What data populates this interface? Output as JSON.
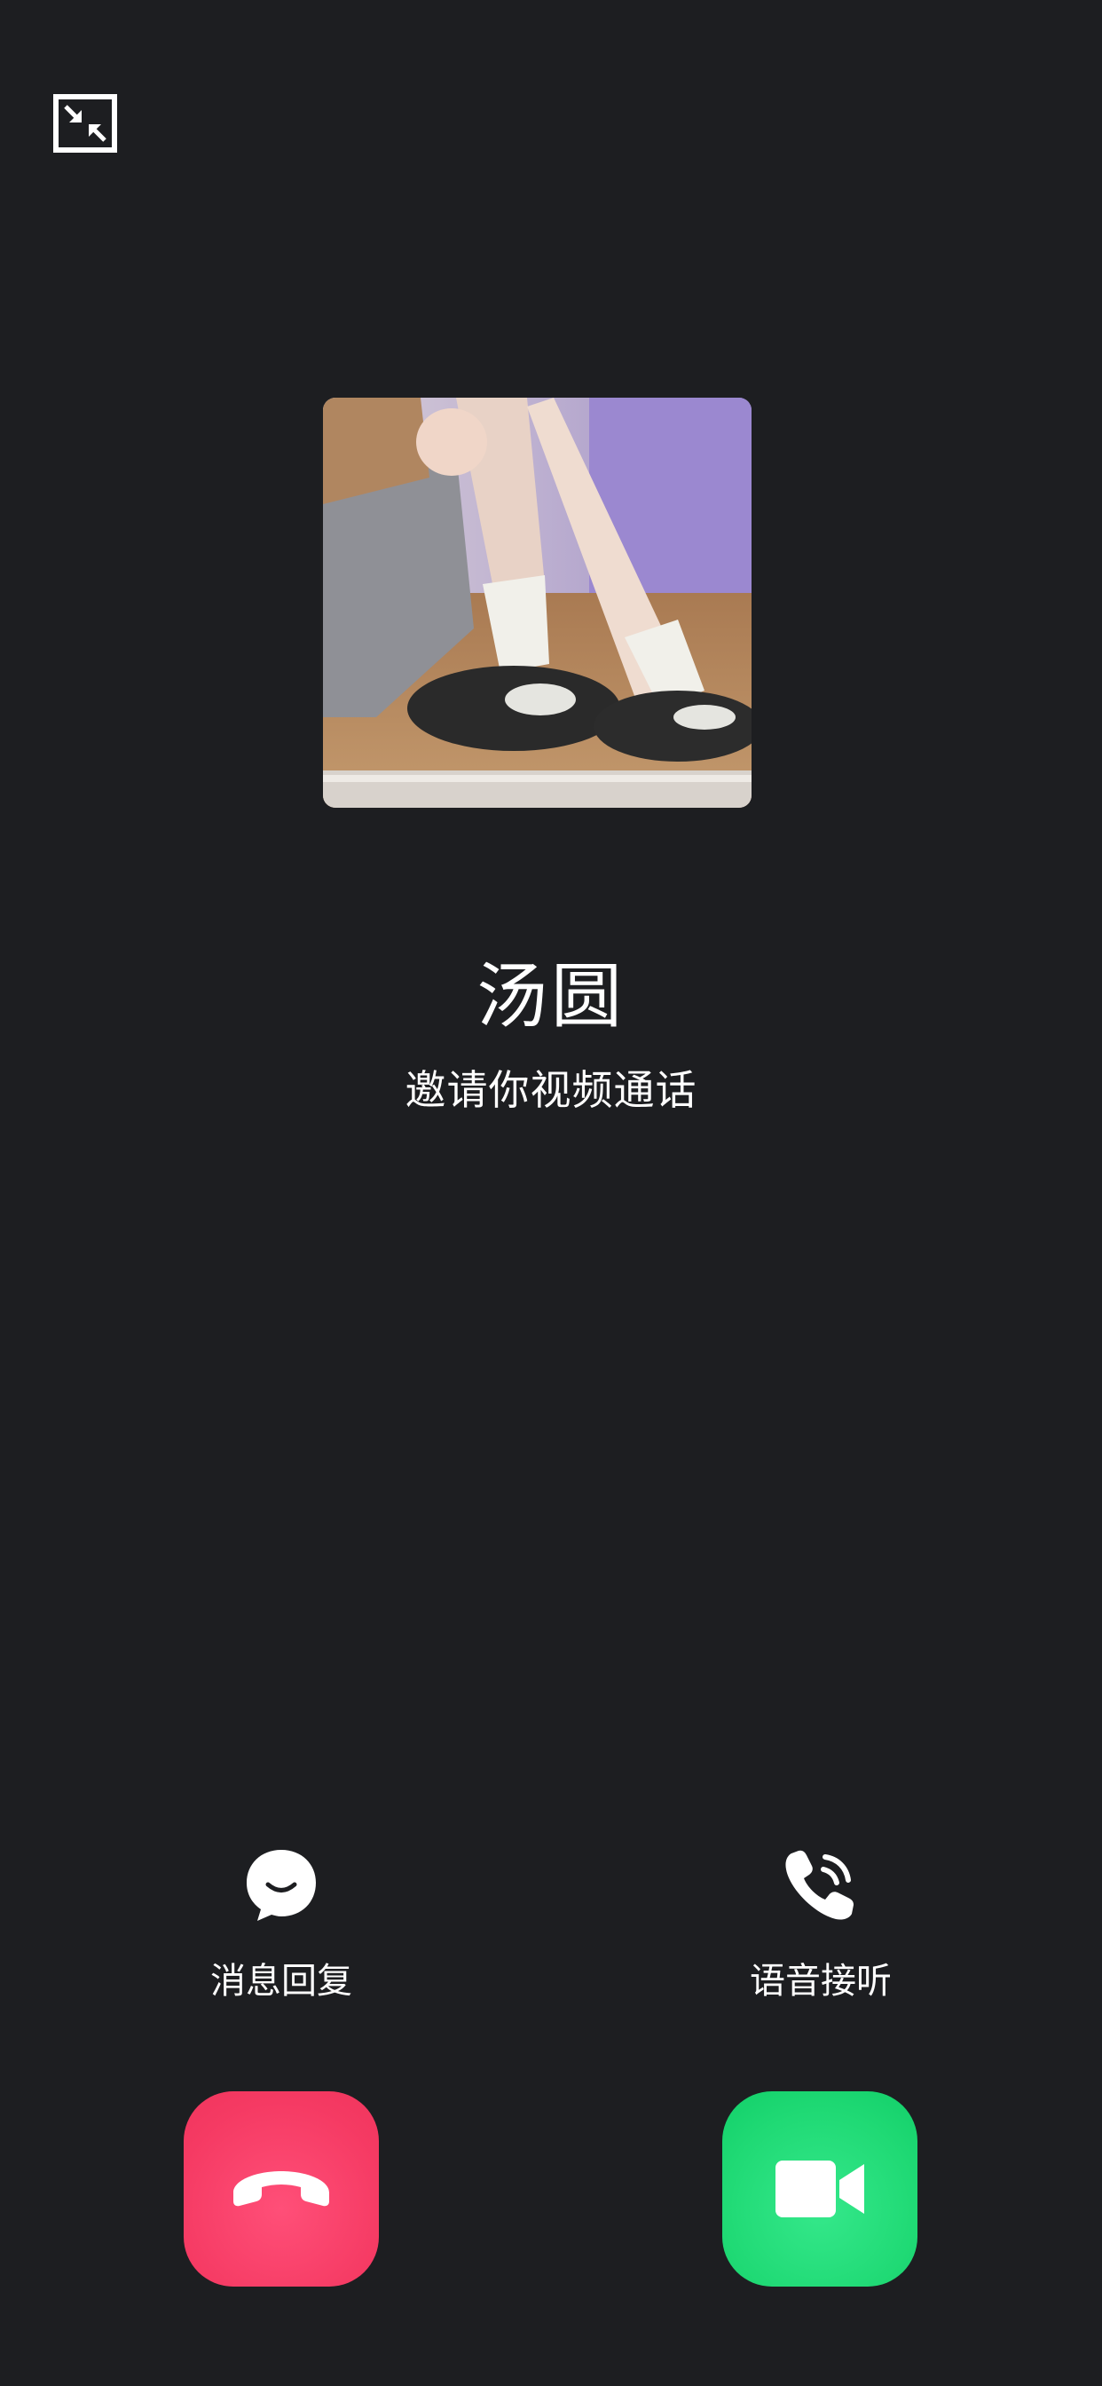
{
  "caller": {
    "name": "汤圆",
    "status": "邀请你视频通话"
  },
  "actions": {
    "reply_label": "消息回复",
    "voice_label": "语音接听"
  },
  "icons": {
    "minimize": "minimize-window-icon",
    "reply": "chat-bubble-icon",
    "voice": "phone-ringing-icon",
    "decline": "hang-up-icon",
    "accept": "video-camera-icon"
  },
  "colors": {
    "background": "#1d1e21",
    "decline": "#f53a63",
    "accept": "#1fd974"
  }
}
